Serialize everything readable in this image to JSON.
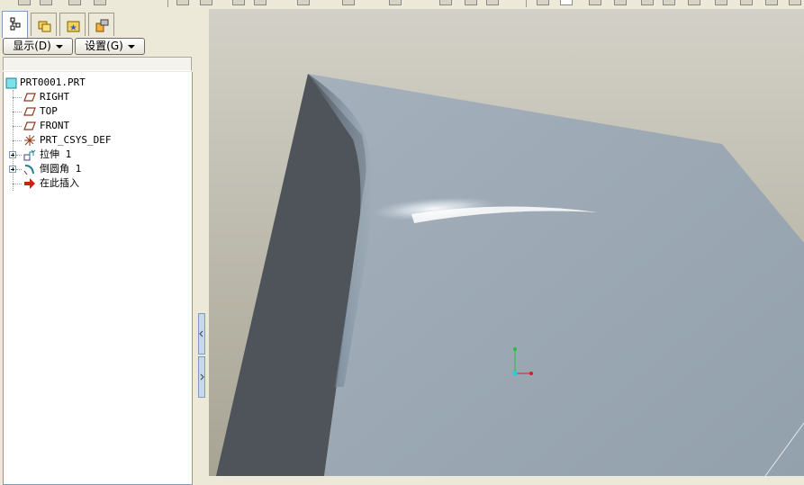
{
  "colors": {
    "background_top": "#d2d0c6",
    "background_bottom": "#a8a595",
    "part_top_face": "#9aa8b4",
    "part_side_face": "#4e545a",
    "tree_bg": "#ffffff",
    "panel_bg": "#ece9d8"
  },
  "tabs": [
    {
      "icon": "model-tree-icon",
      "active": true
    },
    {
      "icon": "folder-browser-icon",
      "active": false
    },
    {
      "icon": "favorites-icon",
      "active": false
    },
    {
      "icon": "connections-icon",
      "active": false
    }
  ],
  "buttons": {
    "show_label": "显示(D)",
    "settings_label": "设置(G)"
  },
  "tree": {
    "root": {
      "label": "PRT0001.PRT",
      "icon": "part-icon"
    },
    "items": [
      {
        "label": "RIGHT",
        "icon": "datum-plane-icon",
        "expandable": false
      },
      {
        "label": "TOP",
        "icon": "datum-plane-icon",
        "expandable": false
      },
      {
        "label": "FRONT",
        "icon": "datum-plane-icon",
        "expandable": false
      },
      {
        "label": "PRT_CSYS_DEF",
        "icon": "coordinate-system-icon",
        "expandable": false
      },
      {
        "label": "拉伸 1",
        "icon": "extrude-icon",
        "expandable": true
      },
      {
        "label": "倒圆角 1",
        "icon": "round-icon",
        "expandable": true
      },
      {
        "label": "在此插入",
        "icon": "insert-here-arrow-icon",
        "expandable": false
      }
    ]
  }
}
